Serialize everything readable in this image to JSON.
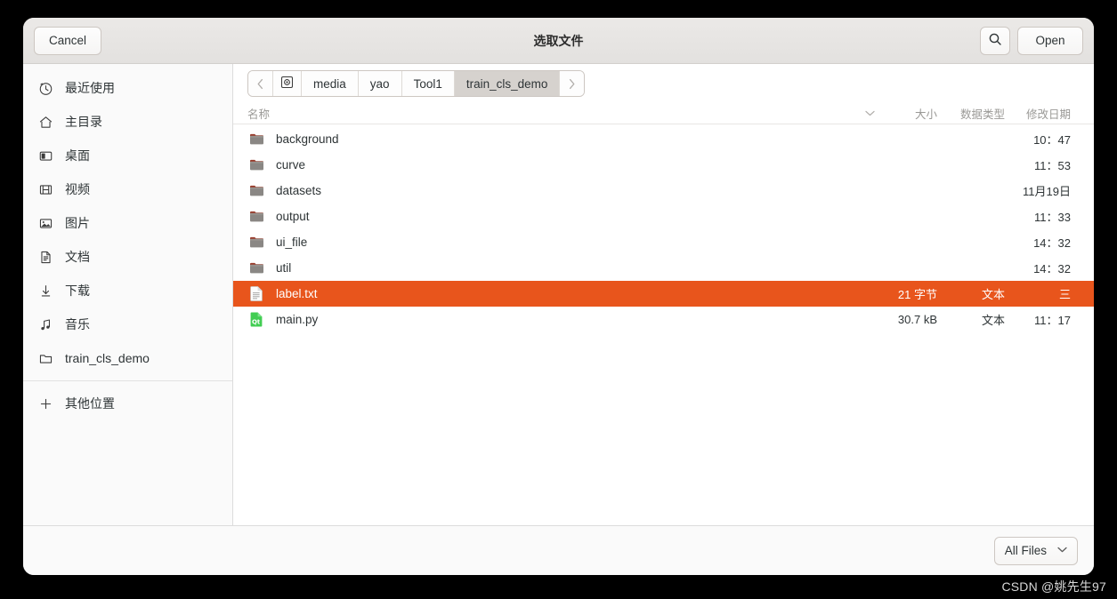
{
  "window": {
    "title": "选取文件"
  },
  "header": {
    "cancel_label": "Cancel",
    "open_label": "Open",
    "search_icon": "search-icon"
  },
  "sidebar": {
    "items": [
      {
        "label": "最近使用",
        "icon": "clock-icon"
      },
      {
        "label": "主目录",
        "icon": "home-icon"
      },
      {
        "label": "桌面",
        "icon": "desktop-icon"
      },
      {
        "label": "视频",
        "icon": "film-icon"
      },
      {
        "label": "图片",
        "icon": "image-icon"
      },
      {
        "label": "文档",
        "icon": "document-icon"
      },
      {
        "label": "下载",
        "icon": "download-icon"
      },
      {
        "label": "音乐",
        "icon": "music-icon"
      },
      {
        "label": "train_cls_demo",
        "icon": "folder-outline-icon"
      }
    ],
    "other_locations": {
      "label": "其他位置",
      "icon": "plus-icon"
    }
  },
  "pathbar": {
    "back_icon": "chevron-left-icon",
    "forward_icon": "chevron-right-icon",
    "root_icon": "disc-icon",
    "crumbs": [
      {
        "label": "media",
        "current": false
      },
      {
        "label": "yao",
        "current": false
      },
      {
        "label": "Tool1",
        "current": false
      },
      {
        "label": "train_cls_demo",
        "current": true
      }
    ]
  },
  "filelist": {
    "columns": {
      "name": "名称",
      "size": "大小",
      "type": "数据类型",
      "date": "修改日期",
      "sort_icon": "chevron-down-icon"
    },
    "rows": [
      {
        "name": "background",
        "icon": "folder-icon",
        "size": "",
        "type": "",
        "date": "10：47",
        "selected": false
      },
      {
        "name": "curve",
        "icon": "folder-icon",
        "size": "",
        "type": "",
        "date": "11：53",
        "selected": false
      },
      {
        "name": "datasets",
        "icon": "folder-icon",
        "size": "",
        "type": "",
        "date": "11月19日",
        "selected": false
      },
      {
        "name": "output",
        "icon": "folder-icon",
        "size": "",
        "type": "",
        "date": "11：33",
        "selected": false
      },
      {
        "name": "ui_file",
        "icon": "folder-icon",
        "size": "",
        "type": "",
        "date": "14：32",
        "selected": false
      },
      {
        "name": "util",
        "icon": "folder-icon",
        "size": "",
        "type": "",
        "date": "14：32",
        "selected": false
      },
      {
        "name": "label.txt",
        "icon": "text-file-icon",
        "size": "21 字节",
        "type": "文本",
        "date": "三",
        "selected": true
      },
      {
        "name": "main.py",
        "icon": "qt-python-file-icon",
        "size": "30.7 kB",
        "type": "文本",
        "date": "11：17",
        "selected": false
      }
    ]
  },
  "footer": {
    "filter_label": "All Files",
    "filter_chevron": "chevron-down-icon"
  },
  "watermark": {
    "text": "CSDN @姚先生97"
  },
  "colors": {
    "selection": "#e8551c",
    "header_bg": "#e7e5e3",
    "sidebar_bg": "#fafafa",
    "folder": "#8a8784",
    "folder_tab": "#9a3b2a",
    "qt_green": "#41cd52"
  }
}
